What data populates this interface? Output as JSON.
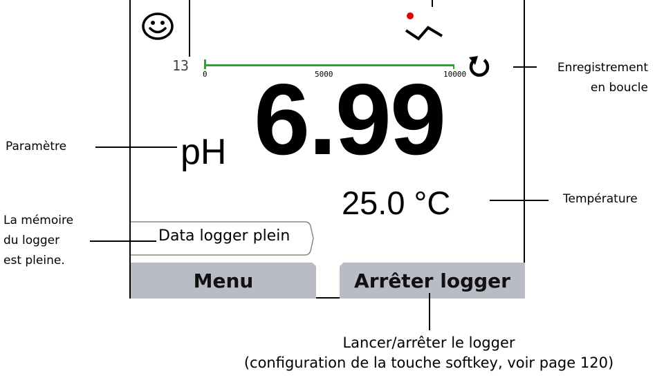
{
  "screen": {
    "record_count": "13",
    "scale": {
      "min": "0",
      "mid": "5000",
      "max": "10000"
    },
    "parameter": "pH",
    "value": "6.99",
    "temperature": "25.0 °C",
    "message": "Data logger plein",
    "softkeys": {
      "left": "Menu",
      "right": "Arrêter logger"
    },
    "colors": {
      "bar": "#22aa22",
      "softkey_bg": "#b9bcc4",
      "recording_dot": "#e00000"
    }
  },
  "callouts": {
    "loop": [
      "Enregistrement",
      "en boucle"
    ],
    "parameter": "Paramètre",
    "temperature": "Température",
    "memory": [
      "La mémoire",
      "du logger",
      "est pleine."
    ],
    "softkey": [
      "Lancer/arrêter le logger",
      "(configuration de la touche softkey, voir page 120)"
    ]
  },
  "icons": [
    "smiley-icon",
    "trend-icon",
    "loop-icon"
  ]
}
